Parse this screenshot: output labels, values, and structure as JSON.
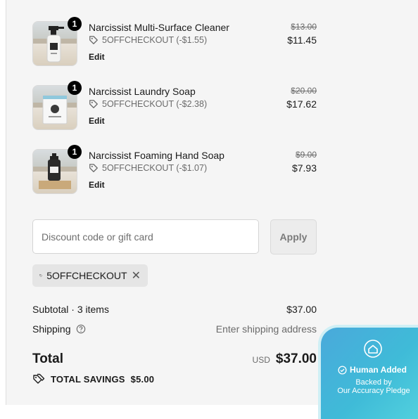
{
  "items": [
    {
      "quantity": "1",
      "name": "Narcissist Multi-Surface Cleaner",
      "discount": "5OFFCHECKOUT (-$1.55)",
      "edit_label": "Edit",
      "original_price": "$13.00",
      "price": "$11.45",
      "image_icon": "spray-bottle"
    },
    {
      "quantity": "1",
      "name": "Narcissist Laundry Soap",
      "discount": "5OFFCHECKOUT (-$2.38)",
      "edit_label": "Edit",
      "original_price": "$20.00",
      "price": "$17.62",
      "image_icon": "soap-box"
    },
    {
      "quantity": "1",
      "name": "Narcissist Foaming Hand Soap",
      "discount": "5OFFCHECKOUT (-$1.07)",
      "edit_label": "Edit",
      "original_price": "$9.00",
      "price": "$7.93",
      "image_icon": "pump-bottle"
    }
  ],
  "discount": {
    "placeholder": "Discount code or gift card",
    "apply_label": "Apply",
    "applied_code": "5OFFCHECKOUT"
  },
  "summary": {
    "subtotal_label": "Subtotal · 3 items",
    "subtotal_value": "$37.00",
    "shipping_label": "Shipping",
    "shipping_value": "Enter shipping address",
    "total_label": "Total",
    "currency": "USD",
    "total_value": "$37.00",
    "savings_label": "TOTAL SAVINGS",
    "savings_value": "$5.00"
  },
  "pledge": {
    "title": "Human Added",
    "line1": "Backed by",
    "line2": "Our Accuracy Pledge"
  },
  "colors": {
    "panel_bg": "#f5f5f5",
    "badge_bg": "#000000",
    "pledge_start": "#4aa9db",
    "pledge_end": "#53d2de"
  }
}
